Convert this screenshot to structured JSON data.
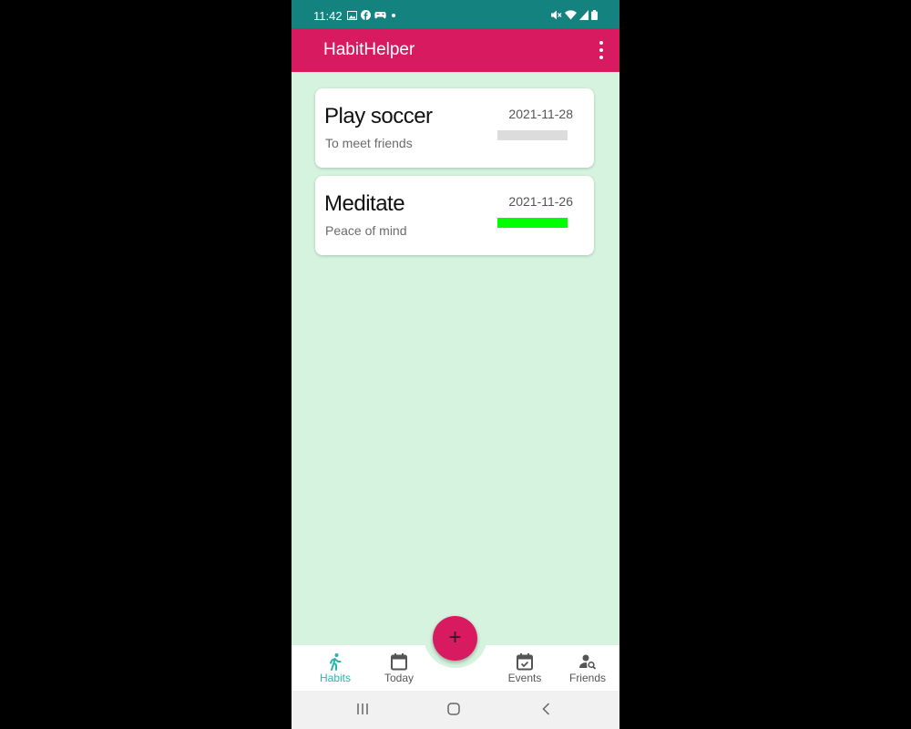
{
  "status_bar": {
    "time": "11:42",
    "left_icons": [
      "image-icon",
      "facebook-icon",
      "gamepad-icon",
      "dot-icon"
    ],
    "right_icons": [
      "mute-icon",
      "wifi-icon",
      "signal-icon",
      "battery-icon"
    ]
  },
  "app_bar": {
    "title": "HabitHelper",
    "menu_icon": "more-vert-icon",
    "color": "#d81b60"
  },
  "habits": [
    {
      "title": "Play soccer",
      "subtitle": "To meet friends",
      "date": "2021-11-28",
      "progress": 0.0,
      "progress_color": "#dcdcdc"
    },
    {
      "title": "Meditate",
      "subtitle": "Peace of mind",
      "date": "2021-11-26",
      "progress": 1.0,
      "progress_color": "#00ff00"
    }
  ],
  "fab": {
    "label": "+",
    "icon": "add-icon"
  },
  "bottom_nav": {
    "items": [
      {
        "label": "Habits",
        "icon": "run-icon",
        "active": true
      },
      {
        "label": "Today",
        "icon": "calendar-icon",
        "active": false
      },
      {
        "label": "Events",
        "icon": "event-check-icon",
        "active": false
      },
      {
        "label": "Friends",
        "icon": "person-search-icon",
        "active": false
      }
    ],
    "active_color": "#2bb5aa"
  },
  "system_nav": [
    "recents-icon",
    "home-icon",
    "back-icon"
  ],
  "colors": {
    "background": "#d5f3de",
    "status_bar": "#14837f"
  }
}
